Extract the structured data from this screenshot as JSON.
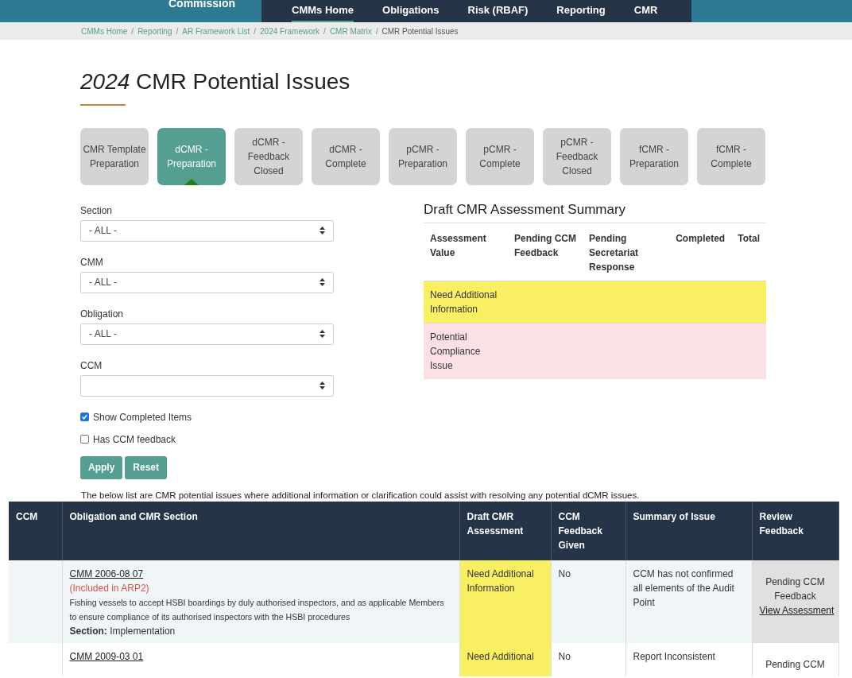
{
  "header": {
    "org_name": "Commission",
    "nav": [
      {
        "label": "CMMs Home",
        "selected": true
      },
      {
        "label": "Obligations",
        "selected": false
      },
      {
        "label": "Risk (RBAF)",
        "selected": false
      },
      {
        "label": "Reporting",
        "selected": false
      },
      {
        "label": "CMR",
        "selected": false
      }
    ]
  },
  "breadcrumb_separator": "/",
  "breadcrumbs": [
    "CMMs Home",
    "Reporting",
    "AR Framework List",
    "2024 Framework",
    "CMR Matrix",
    "CMR Potential Issues"
  ],
  "page_title": {
    "year": "2024",
    "text": "CMR Potential Issues"
  },
  "stages": [
    {
      "label": "CMR Template Preparation",
      "selected": false
    },
    {
      "label": "dCMR - Preparation",
      "selected": true
    },
    {
      "label": "dCMR - Feedback Closed",
      "selected": false
    },
    {
      "label": "dCMR - Complete",
      "selected": false
    },
    {
      "label": "pCMR - Preparation",
      "selected": false
    },
    {
      "label": "pCMR - Complete",
      "selected": false
    },
    {
      "label": "pCMR - Feedback Closed",
      "selected": false
    },
    {
      "label": "fCMR - Preparation",
      "selected": false
    },
    {
      "label": "fCMR - Complete",
      "selected": false
    }
  ],
  "filters": [
    {
      "label": "Section",
      "value": "- ALL -"
    },
    {
      "label": "CMM",
      "value": "- ALL -"
    },
    {
      "label": "Obligation",
      "value": "- ALL -"
    },
    {
      "label": "CCM"
    }
  ],
  "options": [
    {
      "label": "Show Completed Items",
      "checked": true
    },
    {
      "label": "Has CCM feedback",
      "checked": false
    }
  ],
  "buttons": [
    "Apply",
    "Reset"
  ],
  "summary": {
    "title": "Draft CMR Assessment Summary",
    "columns": [
      "Assessment Value",
      "Pending CCM Feedback",
      "Pending Secretariat Response",
      "Completed",
      "Total"
    ],
    "rows": [
      {
        "label": "Need Additional Information",
        "color": "#f9ef63"
      },
      {
        "label": "Potential Compliance Issue",
        "color": "#fbe1e4"
      }
    ]
  },
  "intro": "The below list are CMR potential issues where additional information or clarification could assist with resolving any potential dCMR issues.",
  "table": {
    "columns": [
      "CCM",
      "Obligation and CMR Section",
      "Draft CMR Assessment",
      "CCM Feedback Given",
      "Summary of Issue",
      "Review Feedback"
    ],
    "rows": [
      {
        "cmm": "CMM 2006-08 07",
        "note": "(Included in ARP2)",
        "description": "Fishing vessels to accept HSBI boardings by duly authorised inspectors, and as applicable Members to ensure compliance of its authorised inspectors with the HSBI procedures",
        "section_label": "Section:",
        "section": "Implementation",
        "assessment": "Need Additional Information",
        "color": "#f9ef63",
        "feedback_given": "No",
        "summary": "CCM has not confirmed all elements of the Audit Point",
        "review_status": "Pending CCM Feedback",
        "review_link": "View Assessment"
      },
      {
        "cmm": "CMM 2009-03 01",
        "assessment": "Need Additional",
        "color": "#f9ef63",
        "feedback_given": "No",
        "summary": "Report Inconsistent",
        "review_status": "Pending CCM"
      }
    ]
  }
}
